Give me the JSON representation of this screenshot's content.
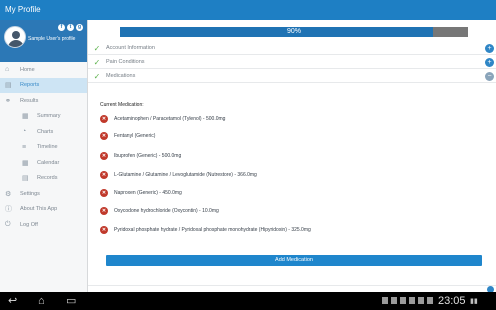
{
  "app": {
    "title": "My Profile"
  },
  "profile": {
    "name": "Sample User's profile",
    "social": [
      "f",
      "t",
      "g"
    ]
  },
  "sidebar": {
    "items": [
      {
        "label": "Home",
        "icon": "home-icon"
      },
      {
        "label": "Reports",
        "icon": "reports-icon",
        "active": true
      },
      {
        "label": "Results",
        "icon": "results-icon"
      },
      {
        "label": "Summary",
        "icon": "summary-icon"
      },
      {
        "label": "Charts",
        "icon": "charts-icon"
      },
      {
        "label": "Timeline",
        "icon": "timeline-icon"
      },
      {
        "label": "Calendar",
        "icon": "calendar-icon"
      },
      {
        "label": "Records",
        "icon": "records-icon"
      },
      {
        "label": "Settings",
        "icon": "settings-icon"
      },
      {
        "label": "About This App",
        "icon": "info-icon"
      },
      {
        "label": "Log Off",
        "icon": "power-icon"
      }
    ]
  },
  "progress": {
    "value": 0.9,
    "label": "90%"
  },
  "sections": [
    {
      "label": "Account Information",
      "toggle": "+"
    },
    {
      "label": "Pain Conditions",
      "toggle": "+"
    },
    {
      "label": "Medications",
      "toggle": "−"
    }
  ],
  "medications": {
    "heading": "Current Medication:",
    "items": [
      "Acetaminophen / Paracetamol (Tylenol) - 500.0mg",
      "Fentanyl (Generic)",
      "Ibuprofen (Generic) - 500.0mg",
      "L-Glutamine / Glutamine / Levoglutamide (Nutrestore) - 366.0mg",
      "Naproxen (Generic) - 450.0mg",
      "Oxycodone hydrochloride (Oxycontin) - 10.0mg",
      "Pyridoxal phosphate hydrate / Pyridoxal phosphate monohydrate (Hipyridoxin) - 325.0mg"
    ],
    "add_label": "Add Medication"
  },
  "system": {
    "time": "23:05"
  },
  "colors": {
    "accent": "#1e7fc4",
    "remove": "#c0392b",
    "check": "#5db34c"
  }
}
